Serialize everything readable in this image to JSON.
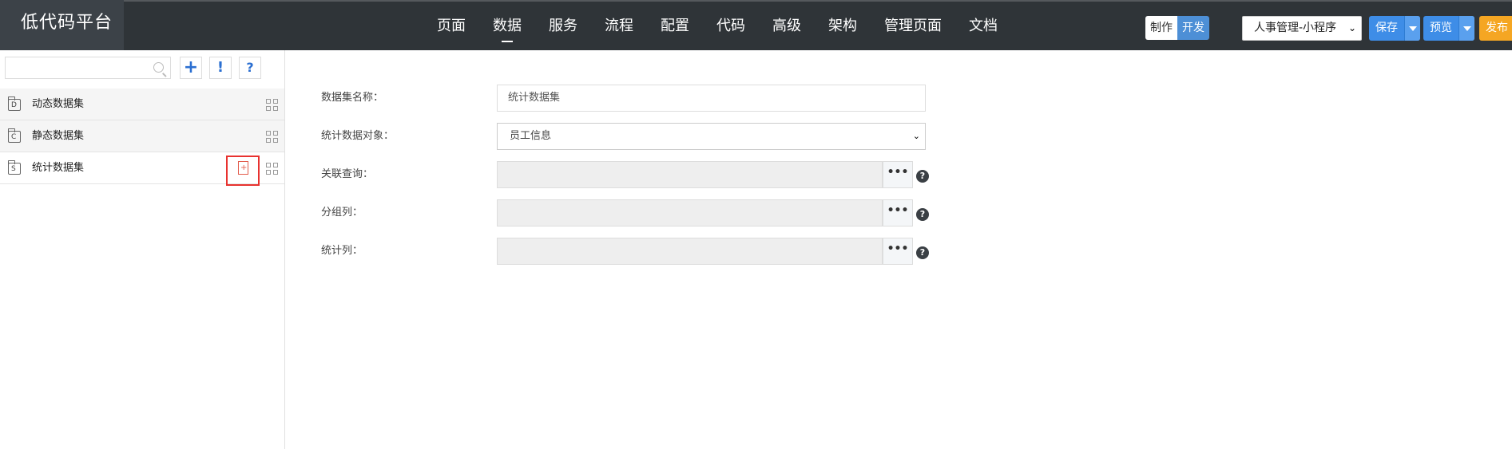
{
  "app": {
    "title": "低代码平台"
  },
  "nav": {
    "items": [
      {
        "label": "页面"
      },
      {
        "label": "数据"
      },
      {
        "label": "服务"
      },
      {
        "label": "流程"
      },
      {
        "label": "配置"
      },
      {
        "label": "代码"
      },
      {
        "label": "高级"
      },
      {
        "label": "架构"
      },
      {
        "label": "管理页面"
      },
      {
        "label": "文档"
      }
    ],
    "active": "数据"
  },
  "mode": {
    "make_label": "制作",
    "dev_label": "开发",
    "active": "开发"
  },
  "app_select": {
    "value": "人事管理-小程序"
  },
  "toolbar": {
    "save_label": "保存",
    "preview_label": "预览",
    "publish_label": "发布"
  },
  "sidebar": {
    "search": {
      "placeholder": ""
    },
    "tools": {
      "add": "+",
      "warn": "!",
      "help": "?"
    },
    "items": [
      {
        "label": "动态数据集",
        "badge": "D"
      },
      {
        "label": "静态数据集",
        "badge": "C"
      },
      {
        "label": "统计数据集",
        "badge": "S"
      }
    ]
  },
  "form": {
    "name_label": "数据集名称：",
    "name_value": "统计数据集",
    "object_label": "统计数据对象：",
    "object_value": "员工信息",
    "relation_label": "关联查询：",
    "group_label": "分组列：",
    "stat_label": "统计列：",
    "more_label": "•••",
    "help_label": "?"
  },
  "colors": {
    "topbar": "#2f3438",
    "accent": "#3e8de7",
    "publish": "#f5a623",
    "highlight": "#e8322f"
  }
}
